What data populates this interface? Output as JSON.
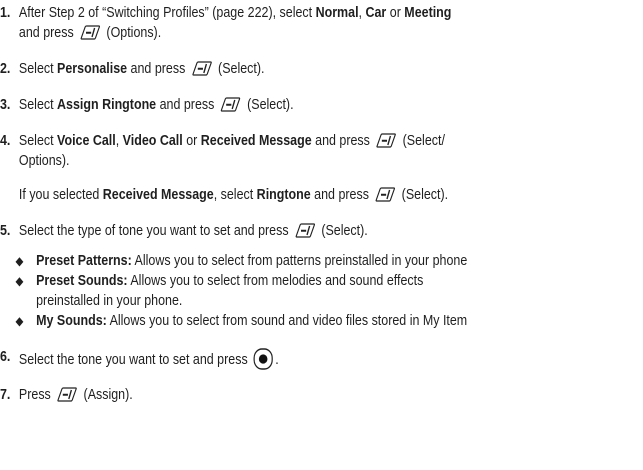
{
  "steps": [
    {
      "number": "1.",
      "lines": [
        [
          "After Step 2 of “Switching Profiles” (page 222), select ",
          "Normal",
          ", ",
          "Car",
          " or ",
          "Meeting"
        ],
        [
          "and press",
          "(Options)."
        ]
      ]
    },
    {
      "number": "2.",
      "pre": "Select ",
      "bold": "Personalise",
      "mid": " and press",
      "post": "(Select)."
    },
    {
      "number": "3.",
      "pre": "Select ",
      "bold": "Assign Ringtone",
      "mid": " and press",
      "post": "(Select)."
    },
    {
      "number": "4.",
      "line1": [
        "Select ",
        "Voice Call",
        ", ",
        "Video Call",
        " or ",
        "Received Message",
        " and press",
        "(Select/"
      ],
      "line2": "Options).",
      "note": [
        "If you selected ",
        "Received Message",
        ", select ",
        "Ringtone",
        " and press",
        "(Select)."
      ]
    },
    {
      "number": "5.",
      "text": "Select the type of tone you want to set and press",
      "post": "(Select)."
    },
    {
      "number": "6.",
      "text": "Select the tone you want to set and press",
      "post": "."
    },
    {
      "number": "7.",
      "pre": "Press",
      "post": "(Assign)."
    }
  ],
  "bullets": [
    {
      "symbol": "◆",
      "term": "Preset Patterns:",
      "desc": " Allows you to select from patterns preinstalled in your phone"
    },
    {
      "symbol": "◆",
      "term": "Preset Sounds:",
      "desc": " Allows you to select from melodies and sound effects",
      "cont": "preinstalled in your phone."
    },
    {
      "symbol": "◆",
      "term": "My Sounds:",
      "desc": " Allows you to select from sound and video files stored in My Item"
    }
  ],
  "icons": {
    "softkey": "left-softkey-icon",
    "center": "center-select-key-icon"
  }
}
